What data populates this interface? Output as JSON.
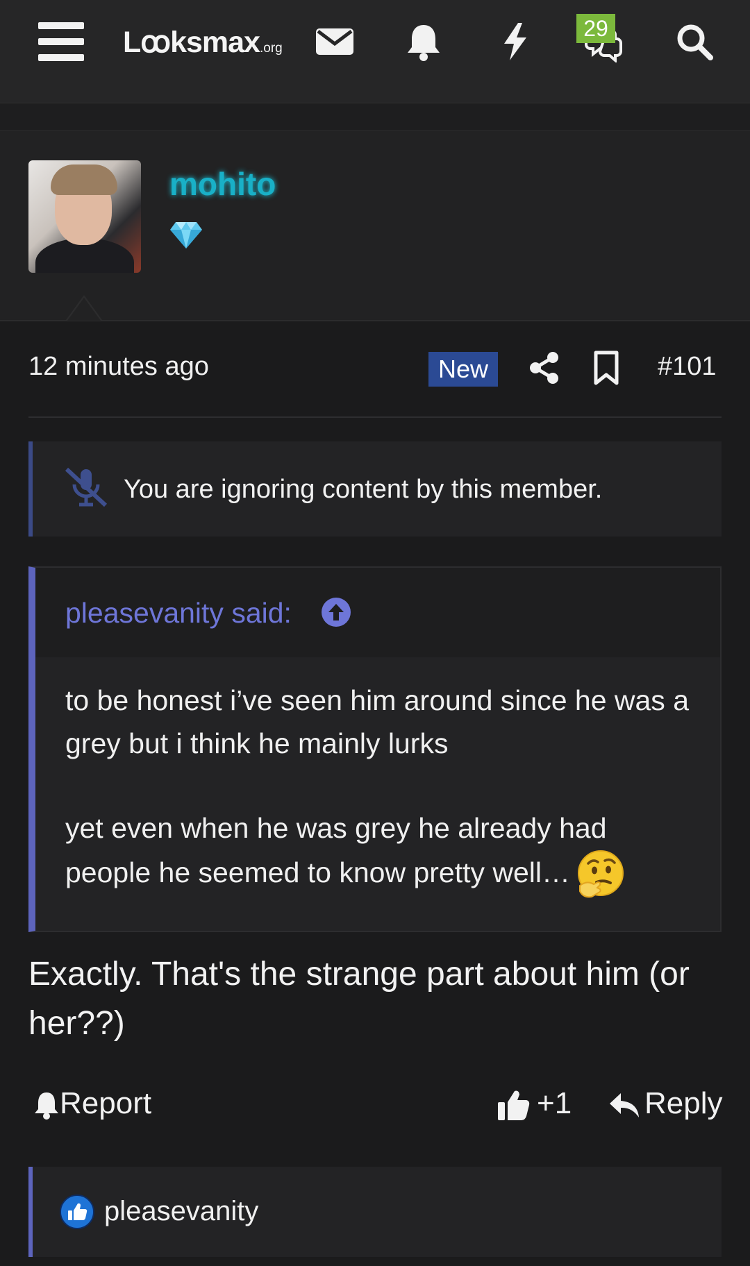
{
  "header": {
    "logo_text": "Lꝏksmax",
    "logo_suffix": ".org",
    "messages_badge": "29"
  },
  "user": {
    "name": "mohito"
  },
  "post": {
    "time": "12 minutes ago",
    "new_label": "New",
    "number": "#101",
    "ignored_text": "You are ignoring content by this member.",
    "quote": {
      "author_label": "pleasevanity said:",
      "paragraph1": "to be honest i’ve seen him around since he was a grey but i think he mainly lurks",
      "paragraph2": "yet even when he was grey he already had people he seemed to know pretty well…"
    },
    "body": "Exactly. That's the strange part about him (or her??)"
  },
  "actions": {
    "report": "Report",
    "like_count": "+1",
    "reply": "Reply"
  },
  "reactions": {
    "users": "pleasevanity"
  },
  "colors": {
    "background": "#1b1b1c",
    "username": "#19b0c7",
    "quote_accent": "#5d64bd",
    "new_badge": "#2b4a94",
    "messages_badge": "#7cb93c"
  }
}
